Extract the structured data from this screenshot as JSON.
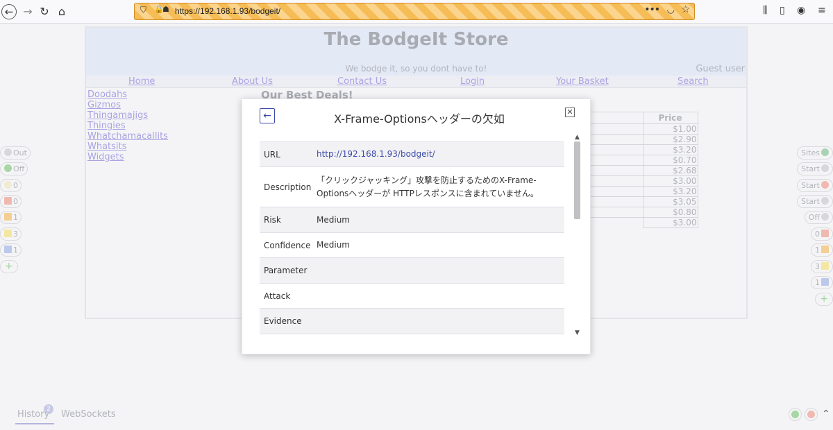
{
  "browser": {
    "url": "https://192.168.1.93/bodgeit/"
  },
  "page": {
    "title": "The BodgeIt Store",
    "tagline": "We bodge it, so you dont have to!",
    "user": "Guest user",
    "menu": [
      "Home",
      "About Us",
      "Contact Us",
      "Login",
      "Your Basket",
      "Search"
    ],
    "categories": [
      "Doodahs",
      "Gizmos",
      "Thingamajigs",
      "Thingies",
      "Whatchamacallits",
      "Whatsits",
      "Widgets"
    ],
    "deals_title": "Our Best Deals!",
    "price_header": "Price",
    "prices": [
      "$1.00",
      "$2.90",
      "$3.20",
      "$0.70",
      "$2.68",
      "$3.00",
      "$3.20",
      "$3.05",
      "$0.80",
      "$3.00"
    ]
  },
  "hud_left": [
    {
      "label": "Out",
      "icon": "circle-icon"
    },
    {
      "label": "Off",
      "icon": "green-dot-icon"
    },
    {
      "label": "0",
      "icon": "lightbulb-icon"
    },
    {
      "label": "0",
      "icon": "red-flag-icon"
    },
    {
      "label": "1",
      "icon": "orange-flag-icon"
    },
    {
      "label": "3",
      "icon": "yellow-flag-icon"
    },
    {
      "label": "1",
      "icon": "blue-flag-icon"
    }
  ],
  "hud_right": [
    {
      "label": "Sites",
      "icon": "globe-icon"
    },
    {
      "label": "Start",
      "icon": "spider-icon"
    },
    {
      "label": "Start",
      "icon": "ajax-spider-icon"
    },
    {
      "label": "Start",
      "icon": "attack-icon"
    },
    {
      "label": "Off",
      "icon": "target-icon"
    },
    {
      "label": "0",
      "icon": "red-flag-icon"
    },
    {
      "label": "1",
      "icon": "orange-flag-icon"
    },
    {
      "label": "3",
      "icon": "yellow-flag-icon"
    },
    {
      "label": "1",
      "icon": "blue-flag-icon"
    }
  ],
  "bottom": {
    "history_label": "History",
    "history_count": "2",
    "websockets_label": "WebSockets"
  },
  "modal": {
    "title": "X-Frame-Optionsヘッダーの欠如",
    "rows": [
      {
        "key": "URL",
        "value": "http://192.168.1.93/bodgeit/"
      },
      {
        "key": "Description",
        "value": "「クリックジャッキング」攻撃を防止するためのX-Frame-Optionsヘッダーが HTTPレスポンスに含まれていません。"
      },
      {
        "key": "Risk",
        "value": "Medium"
      },
      {
        "key": "Confidence",
        "value": "Medium"
      },
      {
        "key": "Parameter",
        "value": ""
      },
      {
        "key": "Attack",
        "value": ""
      },
      {
        "key": "Evidence",
        "value": ""
      }
    ]
  },
  "colors": {
    "accent": "#3d4aa8",
    "link": "#a9a3e3",
    "header_bg": "#e3e9f5"
  }
}
